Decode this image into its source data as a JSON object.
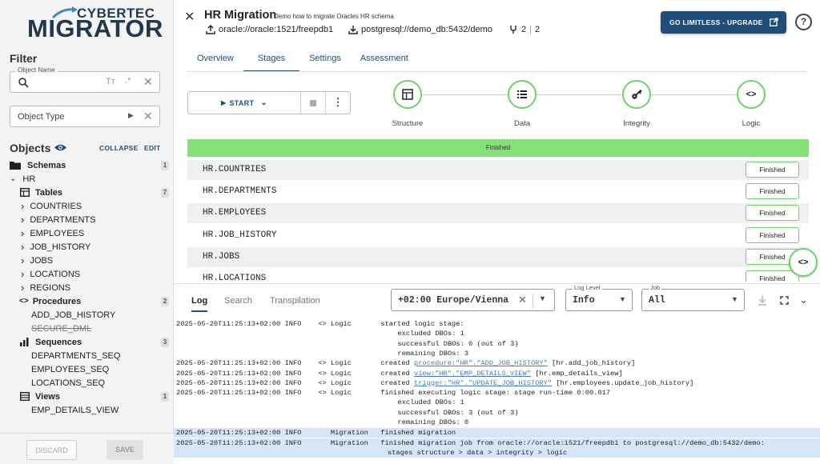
{
  "sidebar": {
    "logo_top": "CYBERTEC",
    "logo_main": "MIGRATOR",
    "filter_title": "Filter",
    "object_name_legend": "Object Name",
    "object_type_placeholder": "Object Type",
    "objects_title": "Objects",
    "collapse_label": "COLLAPSE",
    "edit_label": "EDIT",
    "tree": {
      "schemas_label": "Schemas",
      "schemas_count": "1",
      "hr_label": "HR",
      "tables_label": "Tables",
      "tables_count": "7",
      "tables": [
        "COUNTRIES",
        "DEPARTMENTS",
        "EMPLOYEES",
        "JOB_HISTORY",
        "JOBS",
        "LOCATIONS",
        "REGIONS"
      ],
      "procedures_label": "Procedures",
      "procedures_count": "2",
      "procedures": [
        "ADD_JOB_HISTORY",
        "SECURE_DML"
      ],
      "sequences_label": "Sequences",
      "sequences_count": "3",
      "sequences": [
        "DEPARTMENTS_SEQ",
        "EMPLOYEES_SEQ",
        "LOCATIONS_SEQ"
      ],
      "views_label": "Views",
      "views_count": "1",
      "views": [
        "EMP_DETAILS_VIEW"
      ]
    },
    "discard_label": "DISCARD",
    "save_label": "SAVE"
  },
  "header": {
    "title": "HR Migration",
    "subtitle": "Demo how to migrate Oracles HR schema",
    "source": "oracle://oracle:1521/freepdb1",
    "target": "postgresql://demo_db:5432/demo",
    "branch_a": "2",
    "branch_b": "2",
    "upgrade_label": "GO LIMITLESS - UPGRADE",
    "help_label": "?"
  },
  "tabs": [
    "Overview",
    "Stages",
    "Settings",
    "Assessment"
  ],
  "start_label": "START",
  "stages": [
    "Structure",
    "Data",
    "Integrity",
    "Logic"
  ],
  "finished_bar": "Finished",
  "objects": [
    {
      "name": "HR.COUNTRIES",
      "status": "Finished"
    },
    {
      "name": "HR.DEPARTMENTS",
      "status": "Finished"
    },
    {
      "name": "HR.EMPLOYEES",
      "status": "Finished"
    },
    {
      "name": "HR.JOB_HISTORY",
      "status": "Finished"
    },
    {
      "name": "HR.JOBS",
      "status": "Finished"
    },
    {
      "name": "HR.LOCATIONS",
      "status": "Finished"
    }
  ],
  "log": {
    "tabs": [
      "Log",
      "Search",
      "Transpilation"
    ],
    "timezone": "+02:00 Europe/Vienna",
    "level_legend": "Log Level",
    "level_value": "Info",
    "job_legend": "Job",
    "job_value": "All",
    "lines": [
      {
        "ts": "2025-05-20T11:25:13+02:00",
        "lvl": "INFO",
        "src": "<> Logic",
        "msg": "started logic stage:"
      },
      {
        "ts": "",
        "lvl": "",
        "src": "",
        "msg": "  excluded DBOs: 1"
      },
      {
        "ts": "",
        "lvl": "",
        "src": "",
        "msg": "  successful DBOs: 0 (out of 3)"
      },
      {
        "ts": "",
        "lvl": "",
        "src": "",
        "msg": "  remaining DBOs: 3"
      },
      {
        "ts": "2025-05-20T11:25:13+02:00",
        "lvl": "INFO",
        "src": "<> Logic",
        "msg": "created ",
        "link": "procedure:\"HR\".\"ADD_JOB_HISTORY\"",
        "tail": " [hr.add_job_history]"
      },
      {
        "ts": "2025-05-20T11:25:13+02:00",
        "lvl": "INFO",
        "src": "<> Logic",
        "msg": "created ",
        "link": "view:\"HR\".\"EMP_DETAILS_VIEW\"",
        "tail": " [hr.emp_details_view]"
      },
      {
        "ts": "2025-05-20T11:25:13+02:00",
        "lvl": "INFO",
        "src": "<> Logic",
        "msg": "created ",
        "link": "trigger:\"HR\".\"UPDATE_JOB_HISTORY\"",
        "tail": " [hr.employees.update_job_history]"
      },
      {
        "ts": "2025-05-20T11:25:13+02:00",
        "lvl": "INFO",
        "src": "<> Logic",
        "msg": "finished executing logic stage: stage run-time 0:00.017"
      },
      {
        "ts": "",
        "lvl": "",
        "src": "",
        "msg": "  excluded DBOs: 1"
      },
      {
        "ts": "",
        "lvl": "",
        "src": "",
        "msg": "  successful DBOs: 3 (out of 3)"
      },
      {
        "ts": "",
        "lvl": "",
        "src": "",
        "msg": "  remaining DBOs: 0"
      },
      {
        "ts": "2025-05-20T11:25:13+02:00",
        "lvl": "INFO",
        "src": "   Migration",
        "msg": "finished migration",
        "hl": true
      },
      {
        "ts": "2025-05-20T11:25:13+02:00",
        "lvl": "INFO",
        "src": "   Migration",
        "msg": "finished migration job from oracle://oracle:1521/freepdb1 to postgresql://demo_db:5432/demo:",
        "hl": true
      },
      {
        "ts": "",
        "lvl": "",
        "src": "",
        "msg": "stages structure > data > integrity > logic",
        "hl": true
      }
    ]
  },
  "colors": {
    "accent": "#1f4e79",
    "success": "#6fd06f",
    "finished_bar": "#85e07a"
  }
}
